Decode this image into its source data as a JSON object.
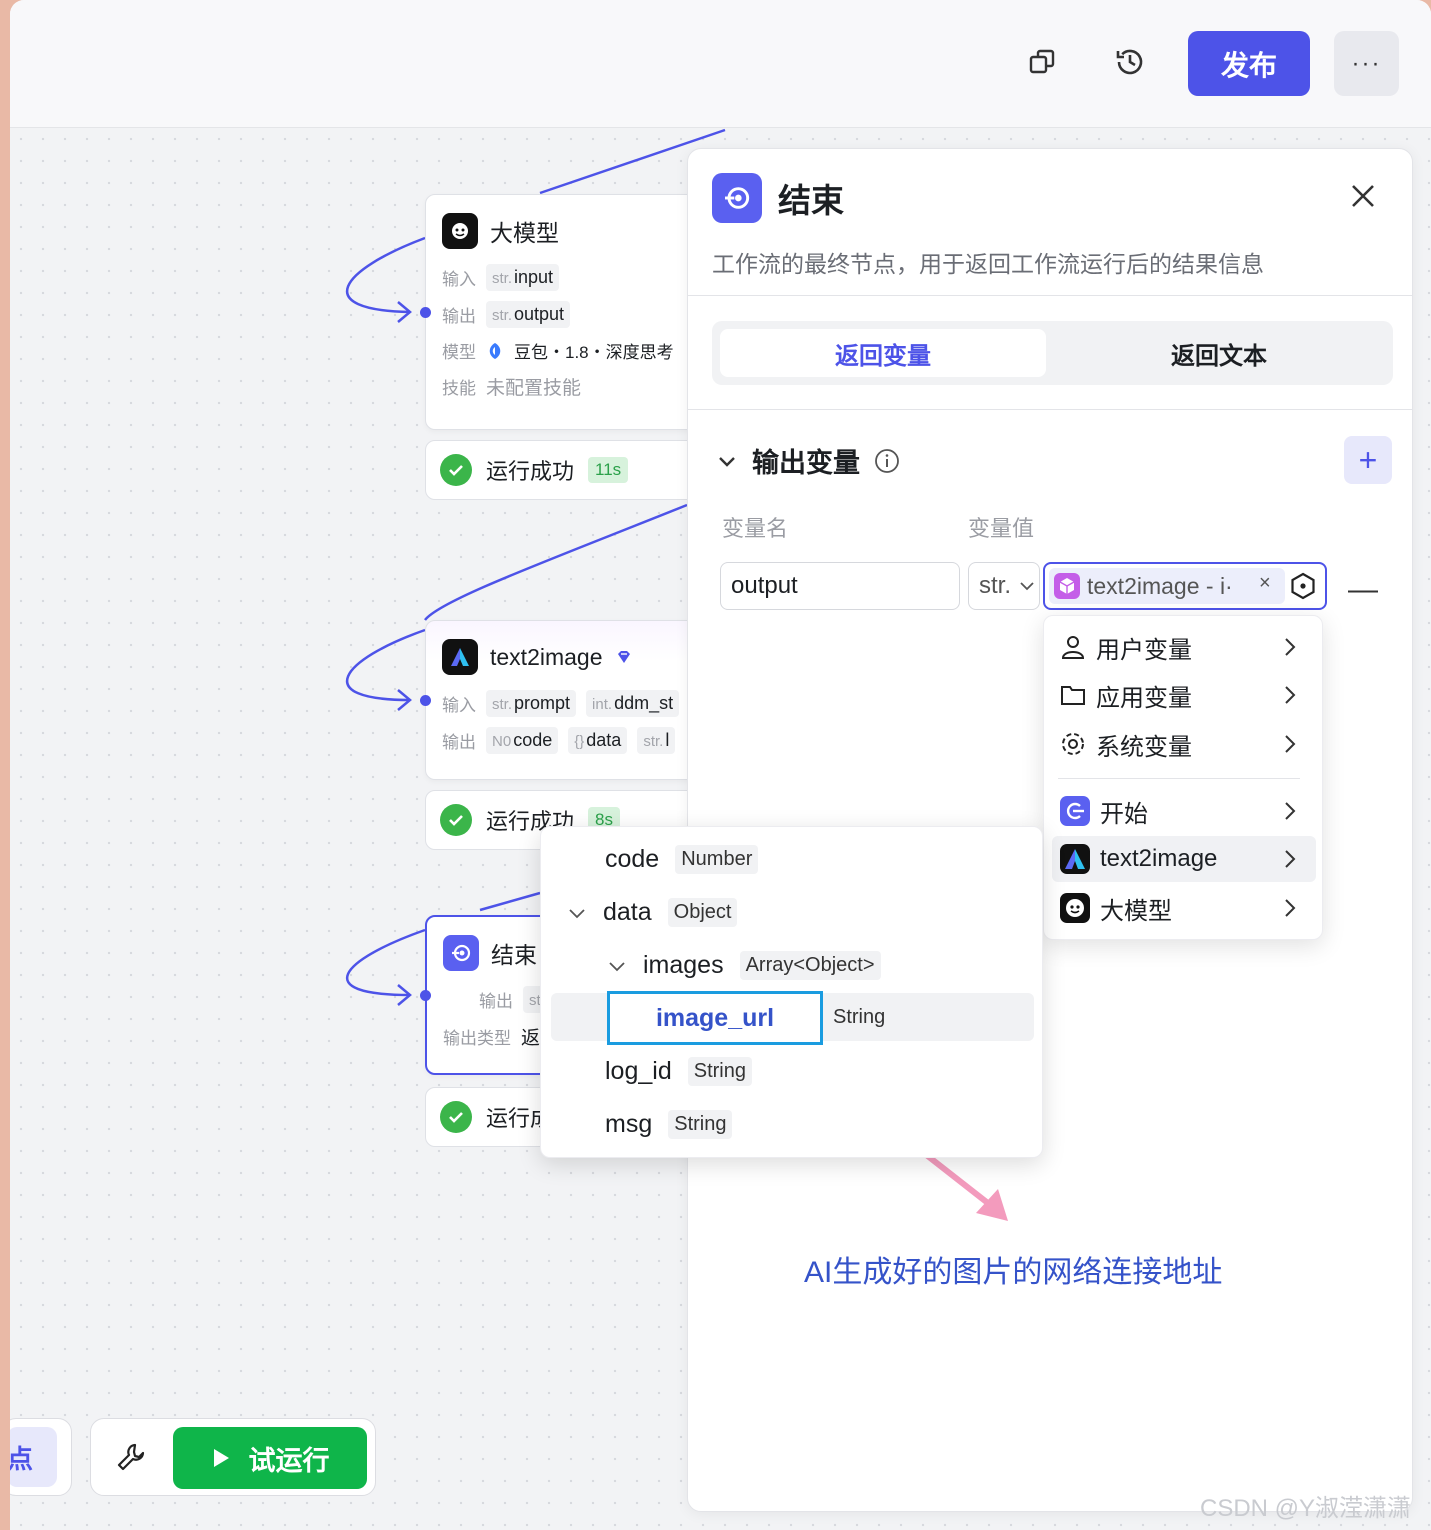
{
  "topbar": {
    "publish_label": "发布",
    "more_label": "···"
  },
  "nodes": {
    "llm": {
      "title": "大模型",
      "input_label": "输入",
      "input_type": "str.",
      "input_name": "input",
      "output_label": "输出",
      "output_type": "str.",
      "output_name": "output",
      "model_label": "模型",
      "model_value": "豆包・1.8・深度思考",
      "skill_label": "技能",
      "skill_value": "未配置技能",
      "status": "运行成功",
      "duration": "11s"
    },
    "t2i": {
      "title": "text2image",
      "input_label": "输入",
      "in1_type": "str.",
      "in1_name": "prompt",
      "in2_type": "int.",
      "in2_name": "ddm_st",
      "output_label": "输出",
      "out1_type": "N0",
      "out1_name": "code",
      "out2_type": "{}",
      "out2_name": "data",
      "out3_type": "str.",
      "out3_name": "l",
      "status": "运行成功",
      "duration": "8s"
    },
    "end": {
      "title": "结束",
      "output_label": "输出",
      "output_type": "st",
      "output_type_label": "输出类型",
      "output_type_value": "返",
      "status": "运行成"
    }
  },
  "panel": {
    "title": "结束",
    "description": "工作流的最终节点，用于返回工作流运行后的结果信息",
    "tabs": [
      "返回变量",
      "返回文本"
    ],
    "section_title": "输出变量",
    "col_name": "变量名",
    "col_value": "变量值",
    "var_name": "output",
    "var_type": "str.",
    "ref_text": "text2image - i·",
    "annotation": "AI生成好的图片的网络连接地址"
  },
  "menu": {
    "items": [
      "用户变量",
      "应用变量",
      "系统变量",
      "开始",
      "text2image",
      "大模型"
    ]
  },
  "submenu": {
    "items": [
      {
        "name": "code",
        "type": "Number"
      },
      {
        "name": "data",
        "type": "Object"
      },
      {
        "name": "images",
        "type": "Array<Object>"
      },
      {
        "name": "image_url",
        "type": "String"
      },
      {
        "name": "log_id",
        "type": "String"
      },
      {
        "name": "msg",
        "type": "String"
      }
    ]
  },
  "bottom": {
    "left_label": "点",
    "run_label": "试运行"
  },
  "watermark": "CSDN @Y淑滢潇潇",
  "colors": {
    "accent": "#4d53e8",
    "success": "#3bb54a",
    "run": "#0fb54a",
    "highlight_border": "#1a9ce0",
    "arrow": "#f39bbd"
  }
}
